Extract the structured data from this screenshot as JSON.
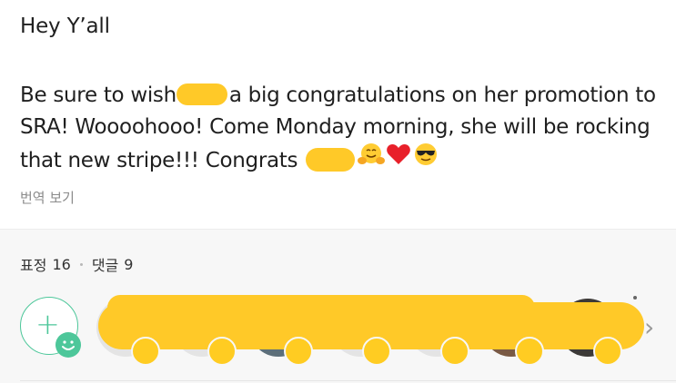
{
  "post": {
    "greeting": "Hey Y’all",
    "body": {
      "part1": "Be sure to wish",
      "part2": "a big congratulations on her promotion to SRA! Woooohooo! Come Monday morning, she will be rocking that new stripe!!! Congrats"
    },
    "emojis": [
      "hugging-face",
      "red-heart",
      "sunglasses-face"
    ],
    "translate_label": "번역 보기"
  },
  "engagement": {
    "reactions_label": "표정",
    "reactions_count": "16",
    "comments_label": "댓글",
    "comments_count": "9"
  },
  "colors": {
    "redaction": "#ffc928",
    "accent_green": "#4dc79a",
    "reaction_yellow": "#ffcc22"
  }
}
